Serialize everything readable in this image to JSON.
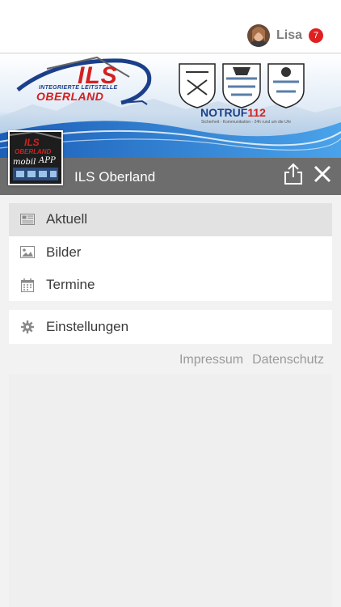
{
  "user": {
    "name": "Lisa",
    "badge_count": "7"
  },
  "banner": {
    "ils": "ILS",
    "ils_subtitle": "INTEGRIERTE LEITSTELLE",
    "oberland": "OBERLAND",
    "notruf_prefix": "NOTRUF",
    "notruf_number": "112",
    "notruf_tagline": "Sicherheit - Kommunikation - 24h rund um die Uhr"
  },
  "app_icon": {
    "ils": "ILS",
    "oberland": "OBERLAND",
    "mobil": "mobil",
    "app": "APP"
  },
  "titlebar": {
    "title": "ILS Oberland"
  },
  "menu": {
    "primary": [
      {
        "label": "Aktuell",
        "icon": "newspaper-icon",
        "active": true
      },
      {
        "label": "Bilder",
        "icon": "image-icon",
        "active": false
      },
      {
        "label": "Termine",
        "icon": "calendar-icon",
        "active": false
      }
    ],
    "secondary": [
      {
        "label": "Einstellungen",
        "icon": "gear-icon",
        "active": false
      }
    ]
  },
  "footer_links": {
    "impressum": "Impressum",
    "datenschutz": "Datenschutz"
  },
  "colors": {
    "badge": "#e02020",
    "titlebar": "#6d6d6d",
    "active_item": "#e2e2e2",
    "brand_red": "#d42020",
    "brand_blue": "#1b3f8a"
  }
}
